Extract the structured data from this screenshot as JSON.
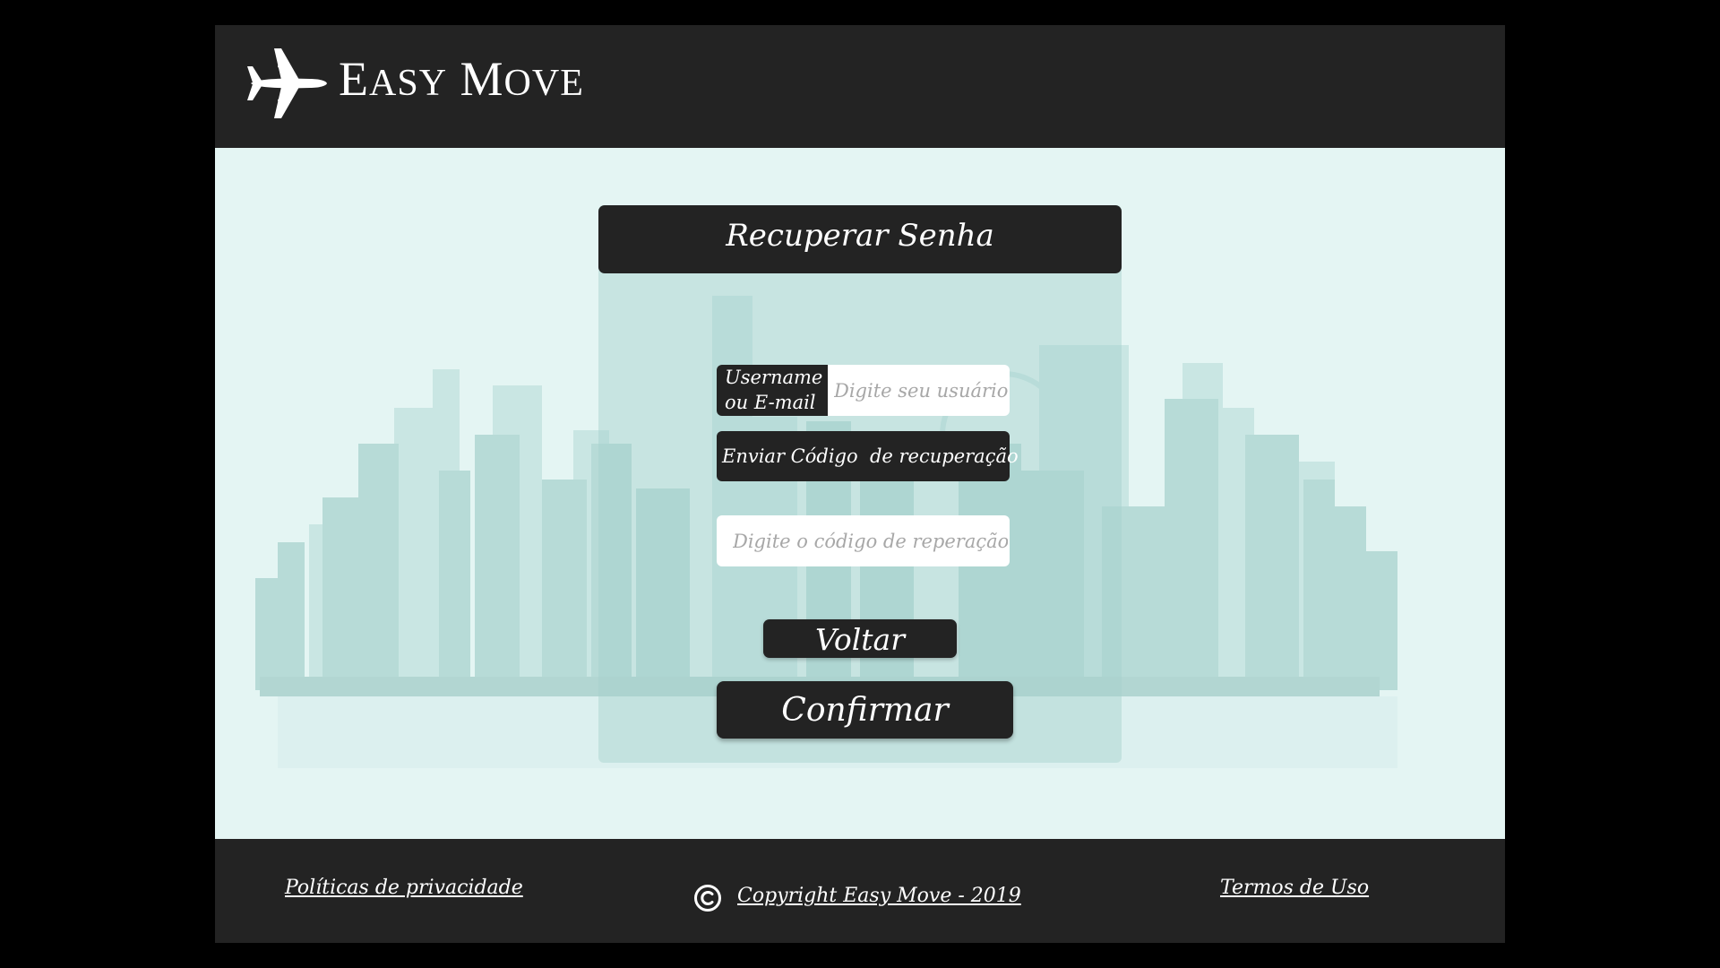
{
  "header": {
    "logo_icon": "airplane-icon",
    "brand_first_letter_1": "E",
    "brand_rest_1": "ASY",
    "brand_first_letter_2": "M",
    "brand_rest_2": "OVE"
  },
  "panel": {
    "title": "Recuperar Senha",
    "username_label": "Username ou E-mail",
    "username_placeholder": "Digite seu usuário",
    "send_code_label": "Enviar Código  de recuperação",
    "code_placeholder": "Digite o código de reperação",
    "back_label": "Voltar",
    "confirm_label": "Confirmar"
  },
  "footer": {
    "privacy_label": "Políticas de privacidade",
    "copyright_icon": "copyright-icon",
    "copyright_label": "Copyright Easy Move - 2019",
    "terms_label": "Termos de Uso"
  },
  "colors": {
    "dark": "#232323",
    "background": "#e4f5f3",
    "skyline": "#b2d8d4",
    "text_light": "#ffffff",
    "placeholder": "#a7a7a7"
  }
}
